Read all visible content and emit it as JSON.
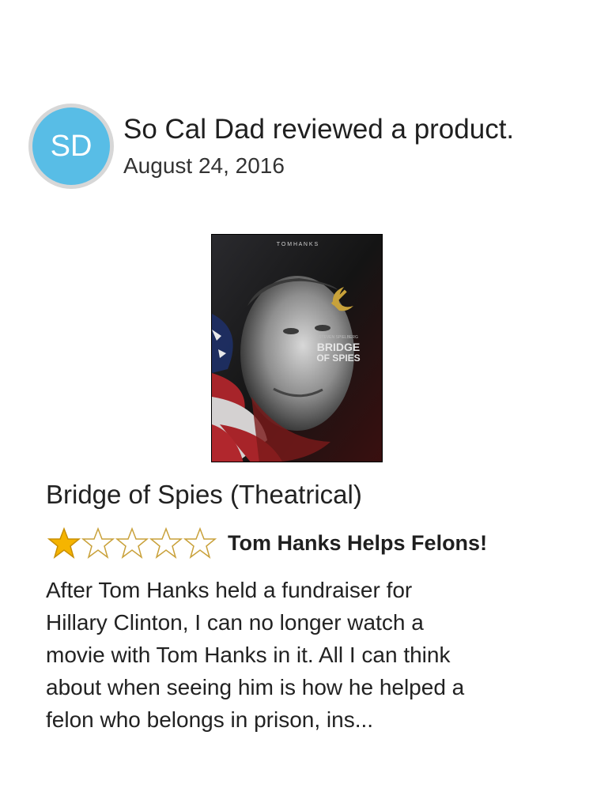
{
  "reviewer": {
    "initials": "SD",
    "avatar_color": "#58bde6",
    "activity": "So Cal Dad reviewed a product.",
    "date": "August 24, 2016"
  },
  "poster": {
    "top_text": "T O M     H A N K S",
    "studio_text": "STEVEN SPIELBERG",
    "title_line1": "BRIDGE",
    "title_line2": "OF SPIES"
  },
  "product": {
    "title": "Bridge of Spies (Theatrical)"
  },
  "review": {
    "rating": 1,
    "max_rating": 5,
    "star_color": "#f5b400",
    "headline": "Tom Hanks Helps Felons!",
    "body_lines": [
      "After Tom Hanks held a fundraiser for",
      "Hillary Clinton, I can no longer watch a",
      "movie with Tom Hanks in it. All I can think",
      "about when seeing him is how he helped a",
      "felon who belongs in prison, ins..."
    ]
  }
}
